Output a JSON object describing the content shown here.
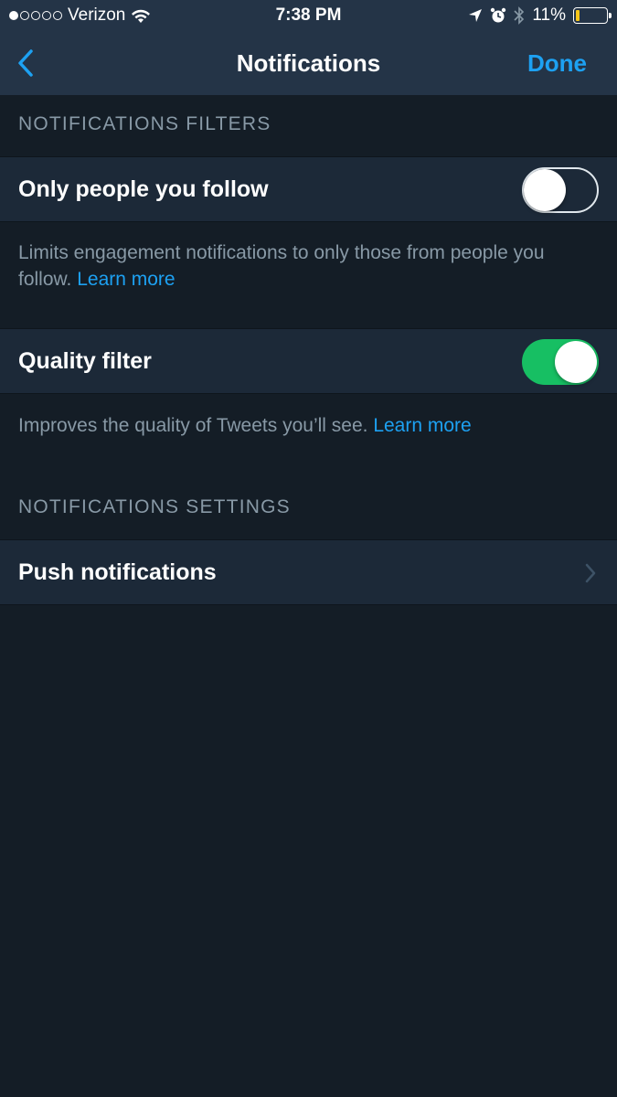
{
  "status_bar": {
    "signal_dots_filled": 1,
    "signal_dots_total": 5,
    "carrier": "Verizon",
    "time": "7:38 PM",
    "battery_percent": "11%",
    "battery_level": 0.11,
    "battery_color": "#f5c518",
    "icons": [
      "wifi-icon",
      "location-arrow-icon",
      "alarm-icon",
      "bluetooth-icon",
      "battery-icon"
    ]
  },
  "nav": {
    "title": "Notifications",
    "done_label": "Done",
    "back_icon": "chevron-left-icon"
  },
  "filters": {
    "header": "NOTIFICATIONS FILTERS",
    "only_people_you_follow": {
      "label": "Only people you follow",
      "enabled": false,
      "description": "Limits engagement notifications to only those from people you follow.",
      "link": "Learn more"
    },
    "quality_filter": {
      "label": "Quality filter",
      "enabled": true,
      "description": "Improves the quality of Tweets you’ll see.",
      "link": "Learn more"
    }
  },
  "settings": {
    "header": "NOTIFICATIONS SETTINGS",
    "push_notifications": {
      "label": "Push notifications",
      "icon": "chevron-right-icon"
    }
  },
  "colors": {
    "accent": "#1da1f2",
    "toggle_on": "#17bf63",
    "background": "#141d26",
    "header_bg": "#243447",
    "row_bg": "#1c2938",
    "secondary_text": "#8899a6"
  }
}
